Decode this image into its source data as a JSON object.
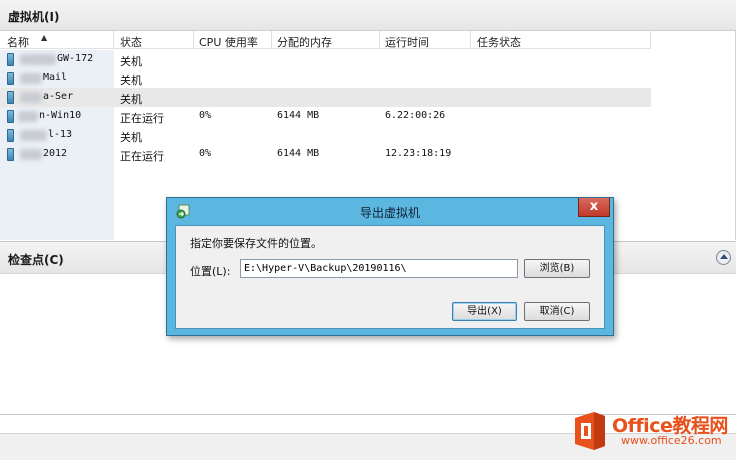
{
  "vm_panel": {
    "title": "虚拟机(I)",
    "columns": [
      "名称",
      "状态",
      "CPU 使用率",
      "分配的内存",
      "运行时间",
      "任务状态"
    ],
    "rows": [
      {
        "name": "GW-172",
        "state": "关机",
        "cpu": "",
        "memory": "",
        "uptime": ""
      },
      {
        "name": "Mail",
        "state": "关机",
        "cpu": "",
        "memory": "",
        "uptime": ""
      },
      {
        "name": "a-Ser",
        "state": "关机",
        "cpu": "",
        "memory": "",
        "uptime": ""
      },
      {
        "name": "n-Win10",
        "state": "正在运行",
        "cpu": "0%",
        "memory": "6144 MB",
        "uptime": "6.22:00:26"
      },
      {
        "name": "l-13",
        "state": "关机",
        "cpu": "",
        "memory": "",
        "uptime": ""
      },
      {
        "name": "2012",
        "state": "正在运行",
        "cpu": "0%",
        "memory": "6144 MB",
        "uptime": "12.23:18:19"
      }
    ]
  },
  "checkpoint_panel": {
    "title": "检查点(C)"
  },
  "dialog": {
    "title": "导出虚拟机",
    "close_glyph": "x",
    "prompt": "指定你要保存文件的位置。",
    "location_label": "位置(L):",
    "location_value": "E:\\Hyper-V\\Backup\\20190116\\",
    "browse_label": "浏览(B)",
    "export_label": "导出(X)",
    "cancel_label": "取消(C)"
  },
  "watermark": {
    "brand": "Office教程网",
    "url": "www.office26.com"
  },
  "colors": {
    "dialog_frame": "#5bb6e0",
    "close_button": "#c0392b",
    "watermark": "#e8501c"
  }
}
